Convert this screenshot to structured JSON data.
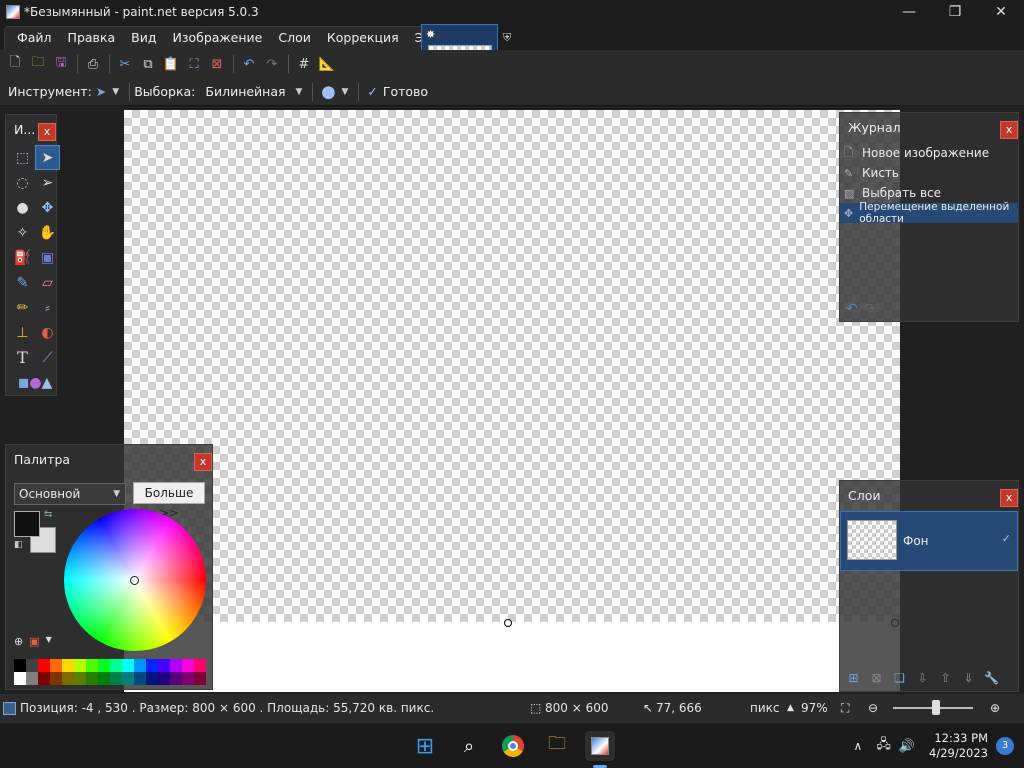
{
  "window": {
    "title": "*Безымянный - paint.net версия 5.0.3",
    "minimize": "—",
    "maximize": "❐",
    "close": "✕"
  },
  "menu": [
    "Файл",
    "Правка",
    "Вид",
    "Изображение",
    "Слои",
    "Коррекция",
    "Эффекты"
  ],
  "options": {
    "tool_label": "Инструмент:",
    "selection_label": "Выборка:",
    "selection_value": "Билинейная",
    "done_label": "Готово"
  },
  "tools_panel": {
    "title": "И...",
    "close": "x"
  },
  "history_panel": {
    "title": "Журнал",
    "close": "x",
    "items": [
      "Новое изображение",
      "Кисть",
      "Выбрать все",
      "Перемещение выделенной области"
    ]
  },
  "layers_panel": {
    "title": "Слои",
    "close": "x",
    "layer_name": "Фон"
  },
  "palette_panel": {
    "title": "Палитра",
    "close": "x",
    "mode": "Основной",
    "more": "Больше >>",
    "colors": {
      "primary": "#111111",
      "secondary": "#dddddd"
    }
  },
  "status": {
    "position": "Позиция: -4 , 530 . Размер: 800  × 600 . Площадь: 55,720 кв. пикс.",
    "image_size": "800 × 600",
    "cursor": "77, 666",
    "units": "пикс",
    "zoom": "97%"
  },
  "taskbar": {
    "time": "12:33 PM",
    "date": "4/29/2023",
    "notifications": "3"
  }
}
